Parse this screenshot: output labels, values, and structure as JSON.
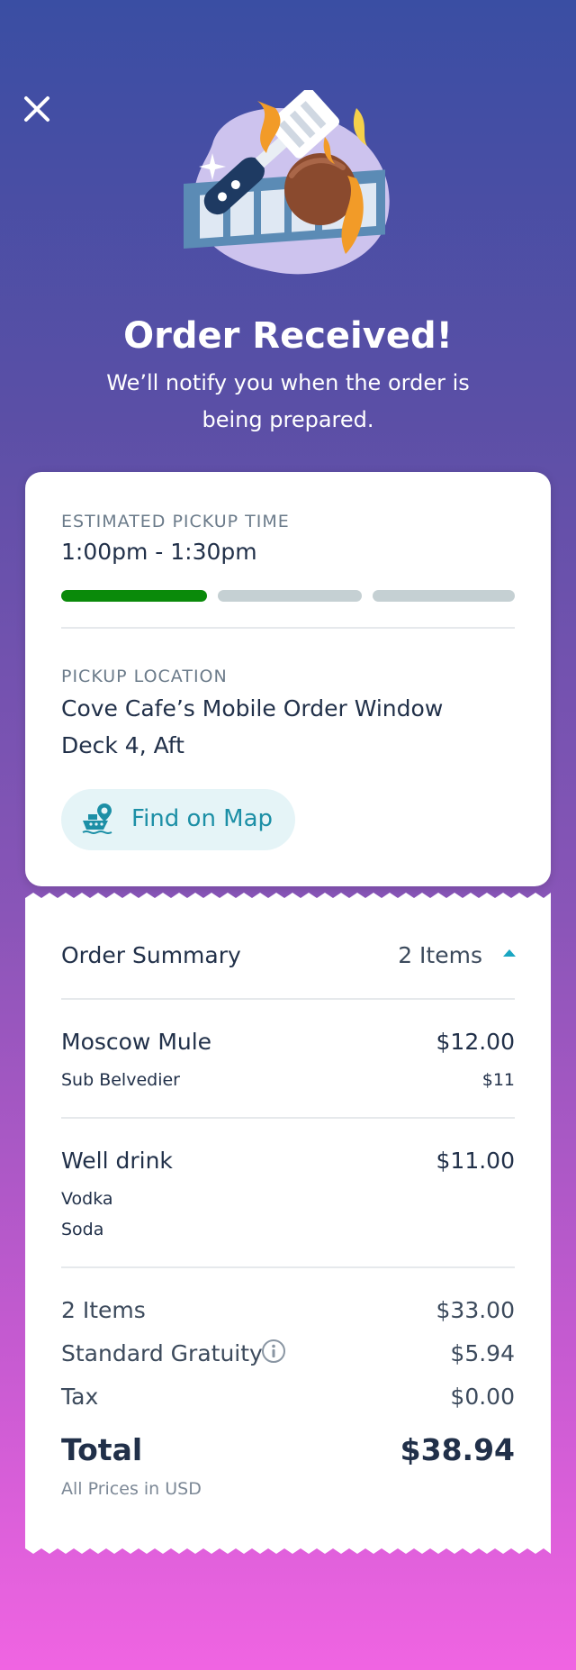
{
  "header": {
    "title": "Order Received!",
    "subtitle": "We’ll notify you when the order is being prepared."
  },
  "icons": {
    "close": "close-icon",
    "hero": "grill-spatula-meatball-illustration",
    "map": "ship-location-icon",
    "info": "info-icon",
    "expand": "caret-up-icon"
  },
  "pickup": {
    "time_label": "ESTIMATED PICKUP TIME",
    "time_value": "1:00pm - 1:30pm",
    "progress_steps_total": 3,
    "progress_steps_done": 1,
    "location_label": "PICKUP LOCATION",
    "location_line1": "Cove Cafe’s Mobile Order Window",
    "location_line2": "Deck 4, Aft",
    "map_button": "Find on Map"
  },
  "summary": {
    "title": "Order Summary",
    "items_count": "2 Items",
    "items": [
      {
        "name": "Moscow Mule",
        "price": "$12.00",
        "mods": [
          {
            "name": "Sub Belvedier",
            "price": "$11"
          }
        ]
      },
      {
        "name": "Well drink",
        "price": "$11.00",
        "mods": [
          {
            "name": "Vodka",
            "price": ""
          },
          {
            "name": "Soda",
            "price": ""
          }
        ]
      }
    ],
    "subtotal_label": "2 Items",
    "subtotal_value": "$33.00",
    "gratuity_label": "Standard Gratuity",
    "gratuity_value": "$5.94",
    "tax_label": "Tax",
    "tax_value": "$0.00",
    "total_label": "Total",
    "total_value": "$38.94",
    "currency_note": "All Prices in USD"
  },
  "colors": {
    "progress_done": "#0a8a0a",
    "progress_todo": "#c5d0d3",
    "accent": "#1c8fa6",
    "text_dark": "#213049"
  }
}
